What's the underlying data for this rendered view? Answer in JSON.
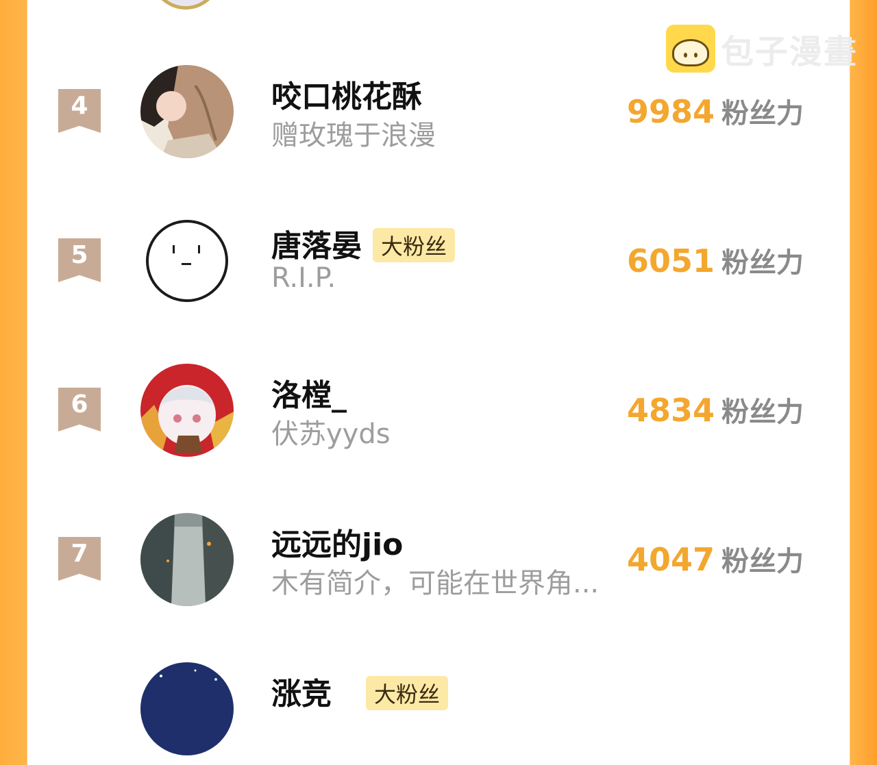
{
  "watermark": {
    "text": "包子漫畫",
    "icon": "bun-logo-icon"
  },
  "score_suffix": "粉丝力",
  "rows": [
    {
      "rank": "4",
      "name": "咬口桃花酥",
      "badge": "",
      "bio": "赠玫瑰于浪漫",
      "score": "9984",
      "avatar": "anime-couple"
    },
    {
      "rank": "5",
      "name": "唐落晏",
      "badge": "大粉丝",
      "bio": "R.I.P.",
      "score": "6051",
      "avatar": "drawn-face"
    },
    {
      "rank": "6",
      "name": "洛樘_",
      "badge": "",
      "bio": "伏苏yyds",
      "score": "4834",
      "avatar": "anime-red-hood"
    },
    {
      "rank": "7",
      "name": "远远的jio",
      "badge": "",
      "bio": "木有简介，可能在世界角...",
      "score": "4047",
      "avatar": "rainy-alley"
    },
    {
      "rank": "",
      "name": "涨竞",
      "badge": "大粉丝",
      "bio": "",
      "score": "",
      "avatar": "starry-night"
    }
  ]
}
